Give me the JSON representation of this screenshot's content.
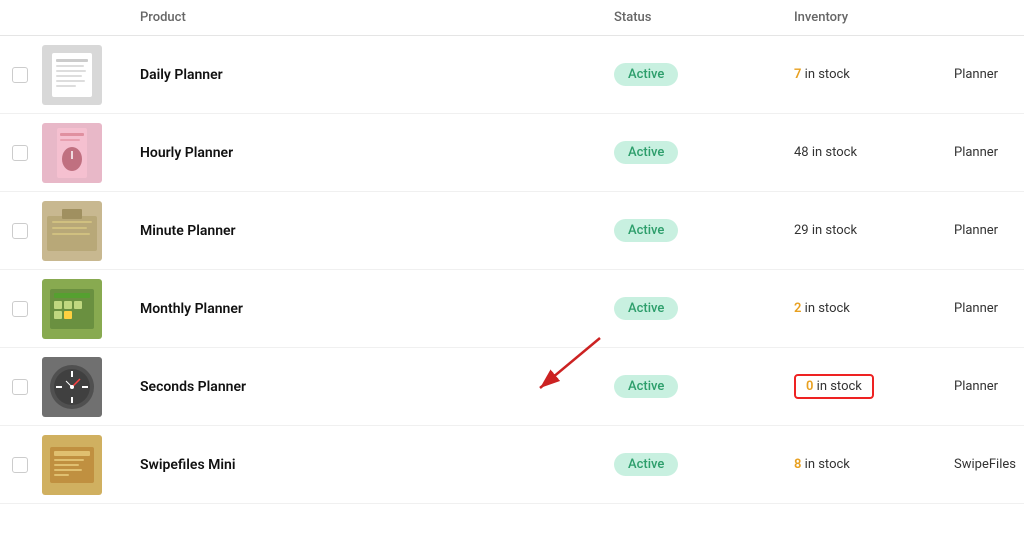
{
  "table": {
    "columns": [
      {
        "key": "checkbox",
        "label": ""
      },
      {
        "key": "image",
        "label": ""
      },
      {
        "key": "product",
        "label": "Product"
      },
      {
        "key": "status",
        "label": "Status"
      },
      {
        "key": "inventory",
        "label": "Inventory"
      },
      {
        "key": "type",
        "label": ""
      },
      {
        "key": "w",
        "label": ""
      }
    ],
    "rows": [
      {
        "id": 1,
        "name": "Daily Planner",
        "status": "Active",
        "stock_prefix": "7",
        "stock_suffix": " in stock",
        "stock_highlight": "orange",
        "inventory_type": "Planner",
        "w": "w",
        "image_color": "#c8c8c8",
        "image_label": "daily"
      },
      {
        "id": 2,
        "name": "Hourly Planner",
        "status": "Active",
        "stock_prefix": "48",
        "stock_suffix": " in stock",
        "stock_highlight": "none",
        "inventory_type": "Planner",
        "w": "w",
        "image_color": "#e0b0c0",
        "image_label": "hourly"
      },
      {
        "id": 3,
        "name": "Minute Planner",
        "status": "Active",
        "stock_prefix": "29",
        "stock_suffix": " in stock",
        "stock_highlight": "none",
        "inventory_type": "Planner",
        "w": "w",
        "image_color": "#c0b090",
        "image_label": "minute"
      },
      {
        "id": 4,
        "name": "Monthly Planner",
        "status": "Active",
        "stock_prefix": "2",
        "stock_suffix": " in stock",
        "stock_highlight": "orange",
        "inventory_type": "Planner",
        "w": "w",
        "image_color": "#90b060",
        "image_label": "monthly"
      },
      {
        "id": 5,
        "name": "Seconds Planner",
        "status": "Active",
        "stock_prefix": "0",
        "stock_suffix": " in stock",
        "stock_highlight": "orange",
        "stock_annotated": true,
        "inventory_type": "Planner",
        "w": "w",
        "image_color": "#808080",
        "image_label": "seconds"
      },
      {
        "id": 6,
        "name": "Swipefiles Mini",
        "status": "Active",
        "stock_prefix": "8",
        "stock_suffix": " in stock",
        "stock_highlight": "orange",
        "inventory_type": "SwipeFiles",
        "w": "w",
        "image_color": "#d0b070",
        "image_label": "swipefiles"
      }
    ]
  },
  "colors": {
    "active_badge_bg": "#c8f0e0",
    "active_badge_text": "#2d9e6b",
    "orange": "#e8a020",
    "red": "#e22222"
  }
}
